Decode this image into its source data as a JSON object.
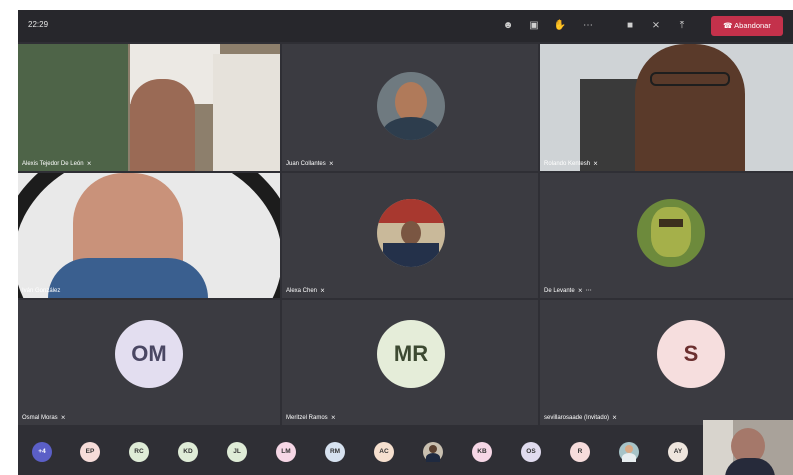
{
  "topbar": {
    "time": "22:29",
    "leave_label": "Abandonar",
    "icons": [
      "people-icon",
      "chat-icon",
      "raise-hand-icon",
      "more-options-icon",
      "camera-icon",
      "mic-muted-icon",
      "share-screen-icon",
      "phone-hangup-icon"
    ]
  },
  "tiles": [
    {
      "name": "Alexis Tejedor De León"
    },
    {
      "name": "Juan Collantes"
    },
    {
      "name": "Rolando Kentesh"
    },
    {
      "name": "Iván González"
    },
    {
      "name": "Alexa Chen"
    },
    {
      "name": "De Levante"
    },
    {
      "name": "Osmal Moras",
      "initials": "OM",
      "color": "#e3def0"
    },
    {
      "name": "Meritzel Ramos",
      "initials": "MR",
      "color": "#e5edd9"
    },
    {
      "name": "sevillarosaade (Invitado)",
      "initials": "S",
      "color": "#f6dede"
    }
  ],
  "bottom": {
    "overflow": "+4",
    "avatars": [
      {
        "label": "EP",
        "color": "#f6dcd9"
      },
      {
        "label": "RC",
        "color": "#dfecd7"
      },
      {
        "label": "KD",
        "color": "#dfecd7"
      },
      {
        "label": "JL",
        "color": "#dfecd7"
      },
      {
        "label": "LM",
        "color": "#f6d7e6"
      },
      {
        "label": "RM",
        "color": "#d7e2f0"
      },
      {
        "label": "AC",
        "color": "#f6e0cf"
      },
      {
        "label": "",
        "color": "#c9c0b0"
      },
      {
        "label": "KB",
        "color": "#f6d7e6"
      },
      {
        "label": "OS",
        "color": "#e1dcef"
      },
      {
        "label": "R",
        "color": "#f6dcdc"
      },
      {
        "label": "",
        "color": "#a7c4c8"
      },
      {
        "label": "AY",
        "color": "#efe6de"
      }
    ]
  },
  "colors": {
    "accent": "#c4314b",
    "overflow": "#5b5fc7"
  }
}
